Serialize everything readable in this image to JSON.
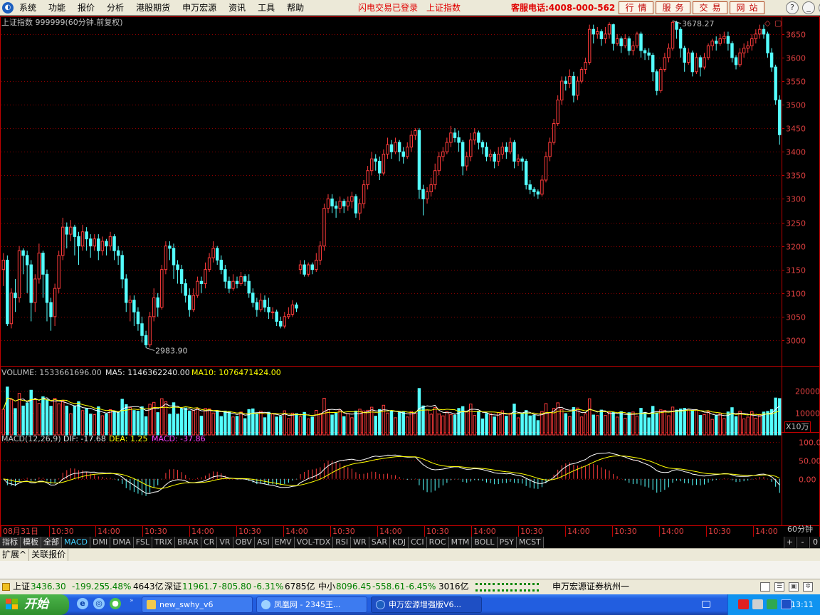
{
  "menu": {
    "logo": "◐",
    "items": [
      "系统",
      "功能",
      "报价",
      "分析",
      "港股期货",
      "申万宏源",
      "资讯",
      "工具",
      "帮助"
    ],
    "status_login": "闪电交易已登录",
    "status_index": "上证指数",
    "hotline": "客服电话:4008-000-562",
    "buttons": [
      "行情",
      "服务",
      "交易",
      "网站"
    ],
    "window_controls": [
      "?",
      "_",
      "❐",
      "×"
    ]
  },
  "chart_data": [
    {
      "type": "candlestick",
      "title": "上证指数 999999(60分钟.前复权)",
      "ylim": [
        2950,
        3680
      ],
      "yticks": [
        3000,
        3050,
        3100,
        3150,
        3200,
        3250,
        3300,
        3350,
        3400,
        3450,
        3500,
        3550,
        3600,
        3650
      ],
      "annotations": [
        {
          "text": "2983.90",
          "value": 2983.9
        },
        {
          "text": "3678.27",
          "value": 3678.27
        }
      ],
      "candles": [
        [
          3150,
          3170,
          3115,
          3185
        ],
        [
          3170,
          3035,
          3030,
          3180
        ],
        [
          3035,
          3100,
          3025,
          3110
        ],
        [
          3100,
          3090,
          3060,
          3130
        ],
        [
          3090,
          3190,
          3080,
          3200
        ],
        [
          3190,
          3180,
          3140,
          3195
        ],
        [
          3180,
          3160,
          3100,
          3190
        ],
        [
          3160,
          3080,
          3040,
          3170
        ],
        [
          3080,
          3130,
          3060,
          3140
        ],
        [
          3130,
          3185,
          3120,
          3205
        ],
        [
          3185,
          3140,
          3090,
          3190
        ],
        [
          3140,
          3080,
          3040,
          3150
        ],
        [
          3080,
          3050,
          3020,
          3090
        ],
        [
          3050,
          3110,
          3030,
          3120
        ],
        [
          3110,
          3180,
          3100,
          3190
        ],
        [
          3180,
          3240,
          3170,
          3260
        ],
        [
          3240,
          3225,
          3195,
          3250
        ],
        [
          3225,
          3240,
          3210,
          3255
        ],
        [
          3240,
          3220,
          3180,
          3245
        ],
        [
          3220,
          3200,
          3160,
          3230
        ],
        [
          3200,
          3230,
          3190,
          3245
        ],
        [
          3230,
          3215,
          3190,
          3240
        ],
        [
          3215,
          3200,
          3175,
          3225
        ],
        [
          3200,
          3215,
          3190,
          3225
        ],
        [
          3215,
          3190,
          3170,
          3225
        ],
        [
          3190,
          3210,
          3180,
          3220
        ],
        [
          3210,
          3200,
          3180,
          3215
        ],
        [
          3200,
          3220,
          3190,
          3230
        ],
        [
          3220,
          3190,
          3170,
          3225
        ],
        [
          3190,
          3180,
          3160,
          3200
        ],
        [
          3180,
          3130,
          3110,
          3190
        ],
        [
          3130,
          3080,
          3060,
          3140
        ],
        [
          3080,
          3085,
          3040,
          3095
        ],
        [
          3085,
          3060,
          3030,
          3095
        ],
        [
          3060,
          3035,
          3020,
          3070
        ],
        [
          3035,
          3010,
          2995,
          3050
        ],
        [
          3010,
          2990,
          2983.9,
          3020
        ],
        [
          2990,
          3050,
          2985,
          3060
        ],
        [
          3050,
          3090,
          3040,
          3110
        ],
        [
          3090,
          3070,
          3050,
          3100
        ],
        [
          3070,
          3150,
          3065,
          3160
        ],
        [
          3150,
          3200,
          3140,
          3210
        ],
        [
          3200,
          3195,
          3170,
          3210
        ],
        [
          3195,
          3160,
          3130,
          3205
        ],
        [
          3160,
          3150,
          3120,
          3170
        ],
        [
          3150,
          3120,
          3100,
          3160
        ],
        [
          3120,
          3095,
          3080,
          3130
        ],
        [
          3095,
          3065,
          3050,
          3110
        ],
        [
          3065,
          3095,
          3060,
          3110
        ],
        [
          3095,
          3125,
          3090,
          3135
        ],
        [
          3125,
          3120,
          3100,
          3135
        ],
        [
          3120,
          3150,
          3110,
          3165
        ],
        [
          3150,
          3175,
          3145,
          3185
        ],
        [
          3175,
          3195,
          3165,
          3210
        ],
        [
          3195,
          3170,
          3160,
          3200
        ],
        [
          3170,
          3150,
          3140,
          3180
        ],
        [
          3150,
          3125,
          3110,
          3160
        ],
        [
          3125,
          3110,
          3100,
          3135
        ],
        [
          3110,
          3125,
          3105,
          3140
        ],
        [
          3125,
          3120,
          3110,
          3135
        ],
        [
          3120,
          3135,
          3115,
          3145
        ],
        [
          3135,
          3125,
          3115,
          3140
        ],
        [
          3125,
          3100,
          3090,
          3140
        ],
        [
          3100,
          3080,
          3070,
          3110
        ],
        [
          3080,
          3065,
          3050,
          3090
        ],
        [
          3065,
          3085,
          3060,
          3100
        ],
        [
          3085,
          3070,
          3060,
          3095
        ],
        [
          3070,
          3060,
          3045,
          3090
        ],
        [
          3060,
          3060,
          3045,
          3070
        ],
        [
          3060,
          3040,
          3030,
          3065
        ],
        [
          3040,
          3030,
          3025,
          3050
        ],
        [
          3030,
          3050,
          3025,
          3060
        ],
        [
          3050,
          3055,
          3045,
          3070
        ],
        [
          3055,
          3075,
          3050,
          3085
        ],
        [
          3075,
          3068,
          3060,
          3080
        ],
        [
          3150,
          3160,
          3140,
          3170
        ],
        [
          3160,
          3140,
          3135,
          3170
        ],
        [
          3140,
          3160,
          3135,
          3165
        ],
        [
          3160,
          3150,
          3140,
          3165
        ],
        [
          3150,
          3170,
          3145,
          3185
        ],
        [
          3170,
          3200,
          3160,
          3210
        ],
        [
          3200,
          3280,
          3190,
          3290
        ],
        [
          3280,
          3300,
          3270,
          3310
        ],
        [
          3300,
          3285,
          3270,
          3310
        ],
        [
          3285,
          3280,
          3260,
          3295
        ],
        [
          3280,
          3295,
          3270,
          3305
        ],
        [
          3295,
          3285,
          3270,
          3300
        ],
        [
          3285,
          3295,
          3275,
          3305
        ],
        [
          3295,
          3305,
          3280,
          3315
        ],
        [
          3305,
          3270,
          3260,
          3310
        ],
        [
          3270,
          3290,
          3255,
          3300
        ],
        [
          3290,
          3330,
          3280,
          3340
        ],
        [
          3330,
          3360,
          3320,
          3370
        ],
        [
          3360,
          3385,
          3350,
          3400
        ],
        [
          3385,
          3380,
          3360,
          3395
        ],
        [
          3380,
          3355,
          3340,
          3390
        ],
        [
          3355,
          3395,
          3350,
          3405
        ],
        [
          3395,
          3415,
          3385,
          3430
        ],
        [
          3415,
          3400,
          3385,
          3425
        ],
        [
          3400,
          3420,
          3395,
          3430
        ],
        [
          3420,
          3400,
          3380,
          3425
        ],
        [
          3400,
          3390,
          3375,
          3410
        ],
        [
          3390,
          3410,
          3385,
          3420
        ],
        [
          3410,
          3435,
          3400,
          3445
        ],
        [
          3435,
          3445,
          3425,
          3450
        ],
        [
          3445,
          3320,
          3300,
          3450
        ],
        [
          3320,
          3300,
          3265,
          3330
        ],
        [
          3300,
          3315,
          3290,
          3325
        ],
        [
          3315,
          3330,
          3305,
          3345
        ],
        [
          3330,
          3360,
          3320,
          3375
        ],
        [
          3360,
          3390,
          3350,
          3400
        ],
        [
          3390,
          3400,
          3380,
          3410
        ],
        [
          3400,
          3420,
          3395,
          3430
        ],
        [
          3420,
          3440,
          3410,
          3455
        ],
        [
          3440,
          3430,
          3420,
          3450
        ],
        [
          3430,
          3420,
          3400,
          3445
        ],
        [
          3420,
          3370,
          3350,
          3425
        ],
        [
          3370,
          3390,
          3360,
          3400
        ],
        [
          3390,
          3425,
          3380,
          3440
        ],
        [
          3425,
          3440,
          3415,
          3450
        ],
        [
          3440,
          3420,
          3405,
          3445
        ],
        [
          3420,
          3410,
          3395,
          3425
        ],
        [
          3410,
          3390,
          3380,
          3420
        ],
        [
          3390,
          3395,
          3380,
          3405
        ],
        [
          3395,
          3380,
          3365,
          3400
        ],
        [
          3380,
          3395,
          3370,
          3410
        ],
        [
          3395,
          3410,
          3385,
          3420
        ],
        [
          3410,
          3400,
          3385,
          3420
        ],
        [
          3400,
          3420,
          3395,
          3430
        ],
        [
          3420,
          3380,
          3365,
          3425
        ],
        [
          3380,
          3385,
          3370,
          3395
        ],
        [
          3385,
          3380,
          3360,
          3390
        ],
        [
          3380,
          3330,
          3320,
          3385
        ],
        [
          3330,
          3320,
          3310,
          3340
        ],
        [
          3320,
          3315,
          3305,
          3325
        ],
        [
          3315,
          3310,
          3300,
          3320
        ],
        [
          3310,
          3340,
          3305,
          3350
        ],
        [
          3340,
          3390,
          3335,
          3400
        ],
        [
          3390,
          3420,
          3380,
          3430
        ],
        [
          3420,
          3460,
          3415,
          3470
        ],
        [
          3460,
          3510,
          3455,
          3520
        ],
        [
          3510,
          3550,
          3500,
          3560
        ],
        [
          3550,
          3545,
          3530,
          3560
        ],
        [
          3545,
          3560,
          3535,
          3575
        ],
        [
          3560,
          3520,
          3505,
          3570
        ],
        [
          3520,
          3550,
          3510,
          3560
        ],
        [
          3550,
          3575,
          3545,
          3580
        ],
        [
          3575,
          3590,
          3565,
          3600
        ],
        [
          3590,
          3660,
          3585,
          3670
        ],
        [
          3660,
          3650,
          3630,
          3670
        ],
        [
          3650,
          3655,
          3640,
          3665
        ],
        [
          3655,
          3640,
          3625,
          3660
        ],
        [
          3640,
          3650,
          3630,
          3665
        ],
        [
          3650,
          3670,
          3640,
          3675
        ],
        [
          3670,
          3630,
          3615,
          3672
        ],
        [
          3630,
          3640,
          3625,
          3650
        ],
        [
          3640,
          3625,
          3610,
          3645
        ],
        [
          3625,
          3640,
          3620,
          3650
        ],
        [
          3640,
          3615,
          3605,
          3645
        ],
        [
          3615,
          3625,
          3605,
          3635
        ],
        [
          3625,
          3650,
          3620,
          3655
        ],
        [
          3650,
          3615,
          3600,
          3655
        ],
        [
          3615,
          3610,
          3595,
          3620
        ],
        [
          3610,
          3605,
          3595,
          3620
        ],
        [
          3605,
          3570,
          3550,
          3610
        ],
        [
          3570,
          3530,
          3520,
          3575
        ],
        [
          3530,
          3575,
          3525,
          3580
        ],
        [
          3575,
          3600,
          3570,
          3610
        ],
        [
          3600,
          3620,
          3590,
          3630
        ],
        [
          3620,
          3675,
          3615,
          3678.27
        ],
        [
          3675,
          3660,
          3640,
          3678
        ],
        [
          3660,
          3620,
          3600,
          3665
        ],
        [
          3620,
          3590,
          3570,
          3625
        ],
        [
          3590,
          3610,
          3585,
          3620
        ],
        [
          3610,
          3570,
          3560,
          3615
        ],
        [
          3570,
          3600,
          3565,
          3610
        ],
        [
          3600,
          3580,
          3560,
          3605
        ],
        [
          3580,
          3600,
          3575,
          3610
        ],
        [
          3600,
          3625,
          3595,
          3630
        ],
        [
          3625,
          3635,
          3615,
          3640
        ],
        [
          3635,
          3630,
          3615,
          3645
        ],
        [
          3630,
          3640,
          3625,
          3650
        ],
        [
          3640,
          3645,
          3630,
          3655
        ],
        [
          3645,
          3630,
          3615,
          3655
        ],
        [
          3630,
          3600,
          3590,
          3635
        ],
        [
          3600,
          3585,
          3575,
          3605
        ],
        [
          3585,
          3610,
          3580,
          3620
        ],
        [
          3610,
          3620,
          3600,
          3630
        ],
        [
          3620,
          3625,
          3610,
          3635
        ],
        [
          3625,
          3640,
          3615,
          3650
        ],
        [
          3640,
          3650,
          3630,
          3660
        ],
        [
          3650,
          3660,
          3640,
          3670
        ],
        [
          3660,
          3650,
          3640,
          3670
        ],
        [
          3650,
          3610,
          3600,
          3655
        ],
        [
          3610,
          3580,
          3570,
          3620
        ],
        [
          3580,
          3510,
          3500,
          3585
        ],
        [
          3510,
          3436.3,
          3415,
          3520
        ]
      ]
    },
    {
      "type": "bar",
      "title": "VOLUME",
      "label_volume": "VOLUME: 1533661696.00",
      "label_ma5": "MA5: 1146362240.00",
      "label_ma10": "MA10: 1076471424.00",
      "unit_label": "X10万",
      "yticks": [
        10000,
        20000
      ],
      "ylim": [
        0,
        26000
      ]
    },
    {
      "type": "line",
      "title": "MACD(12,26,9)",
      "label_dif": "DIF: -17.68",
      "label_dea": "DEA: 1.25",
      "label_macd": "MACD: -37.86",
      "yticks": [
        "100.0",
        "50.00",
        "0.00"
      ],
      "ylim": [
        -120,
        115
      ]
    }
  ],
  "xaxis": {
    "labels": [
      "08月31日",
      "10:30",
      "14:00",
      "10:30",
      "14:00",
      "10:30",
      "14:00",
      "10:30",
      "14:00",
      "10:30",
      "14:00",
      "10:30",
      "14:00",
      "10:30",
      "14:00",
      "10:30",
      "14:00"
    ],
    "period": "60分钟"
  },
  "indicator_tabs": {
    "labels": [
      "指标",
      "模板",
      "全部",
      "MACD",
      "DMI",
      "DMA",
      "FSL",
      "TRIX",
      "BRAR",
      "CR",
      "VR",
      "OBV",
      "ASI",
      "EMV",
      "VOL-TDX",
      "RSI",
      "WR",
      "SAR",
      "KDJ",
      "CCI",
      "ROC",
      "MTM",
      "BOLL",
      "PSY",
      "MCST"
    ],
    "active": "MACD",
    "zoom": [
      "+",
      "-",
      "0"
    ]
  },
  "expand_tabs": [
    "扩展^",
    "关联报价"
  ],
  "ticker": {
    "sh_name": "上证",
    "sh_price": "3436.30",
    "sh_chg": "-199.25",
    "sh_pct": "-5.48%",
    "sh_amt": "4643亿",
    "sz_name": "深证",
    "sz_price": "11961.7",
    "sz_chg": "-805.80",
    "sz_pct": "-6.31%",
    "sz_amt": "6785亿",
    "zx_name": "中小",
    "zx_price": "8096.45",
    "zx_chg": "-558.61",
    "zx_pct": "-6.45%",
    "zx_amt": "3016亿",
    "broker": "申万宏源证券杭州一"
  },
  "taskbar": {
    "start": "开始",
    "tasks": [
      "new_swhy_v6",
      "凤凰网 - 2345王...",
      "申万宏源增强版V6..."
    ],
    "clock": "13:11"
  },
  "colors": {
    "up": "#ff3b3b",
    "down": "#54ffff",
    "grid": "#8a0000",
    "axis": "#c00000",
    "ma5": "#ffffff",
    "ma10": "#ffff00",
    "macd_label": "#ff40ff"
  }
}
